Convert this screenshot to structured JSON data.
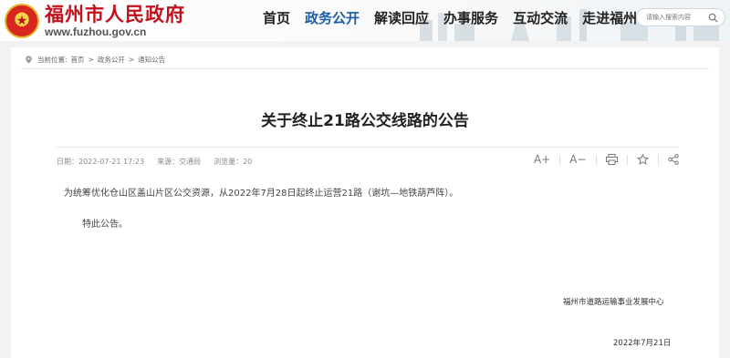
{
  "header": {
    "site_title": "福州市人民政府",
    "site_url": "www.fuzhou.gov.cn",
    "nav": [
      {
        "label": "首页"
      },
      {
        "label": "政务公开",
        "active": true
      },
      {
        "label": "解读回应"
      },
      {
        "label": "办事服务"
      },
      {
        "label": "互动交流"
      },
      {
        "label": "走进福州"
      }
    ],
    "search": {
      "placeholder": "请输入搜索内容"
    }
  },
  "breadcrumb": {
    "prefix": "当前位置:",
    "items": [
      "首页",
      ">",
      "政务公开",
      ">",
      "通知公告"
    ]
  },
  "article": {
    "title": "关于终止21路公交线路的公告",
    "meta": {
      "date": "日期：2022-07-21 17:23",
      "source": "来源：交通局",
      "views": "浏览量：20"
    },
    "tools": [
      {
        "icon": "font-increase-icon",
        "label": "A+"
      },
      {
        "icon": "font-decrease-icon",
        "label": "A−"
      },
      {
        "icon": "print-icon"
      },
      {
        "icon": "favorite-star-icon"
      },
      {
        "icon": "share-icon"
      }
    ],
    "body": "为统筹优化仓山区盖山片区公交资源，从2022年7月28日起终止运营21路（谢坑—地铁葫芦阵）。",
    "closing": "特此公告。",
    "signature": "福州市道路运输事业发展中心",
    "sign_date": "2022年7月21日"
  },
  "colors": {
    "brand_red": "#c1121b",
    "nav_active": "#1a5ea8",
    "page_bg": "#f2f2f2"
  }
}
